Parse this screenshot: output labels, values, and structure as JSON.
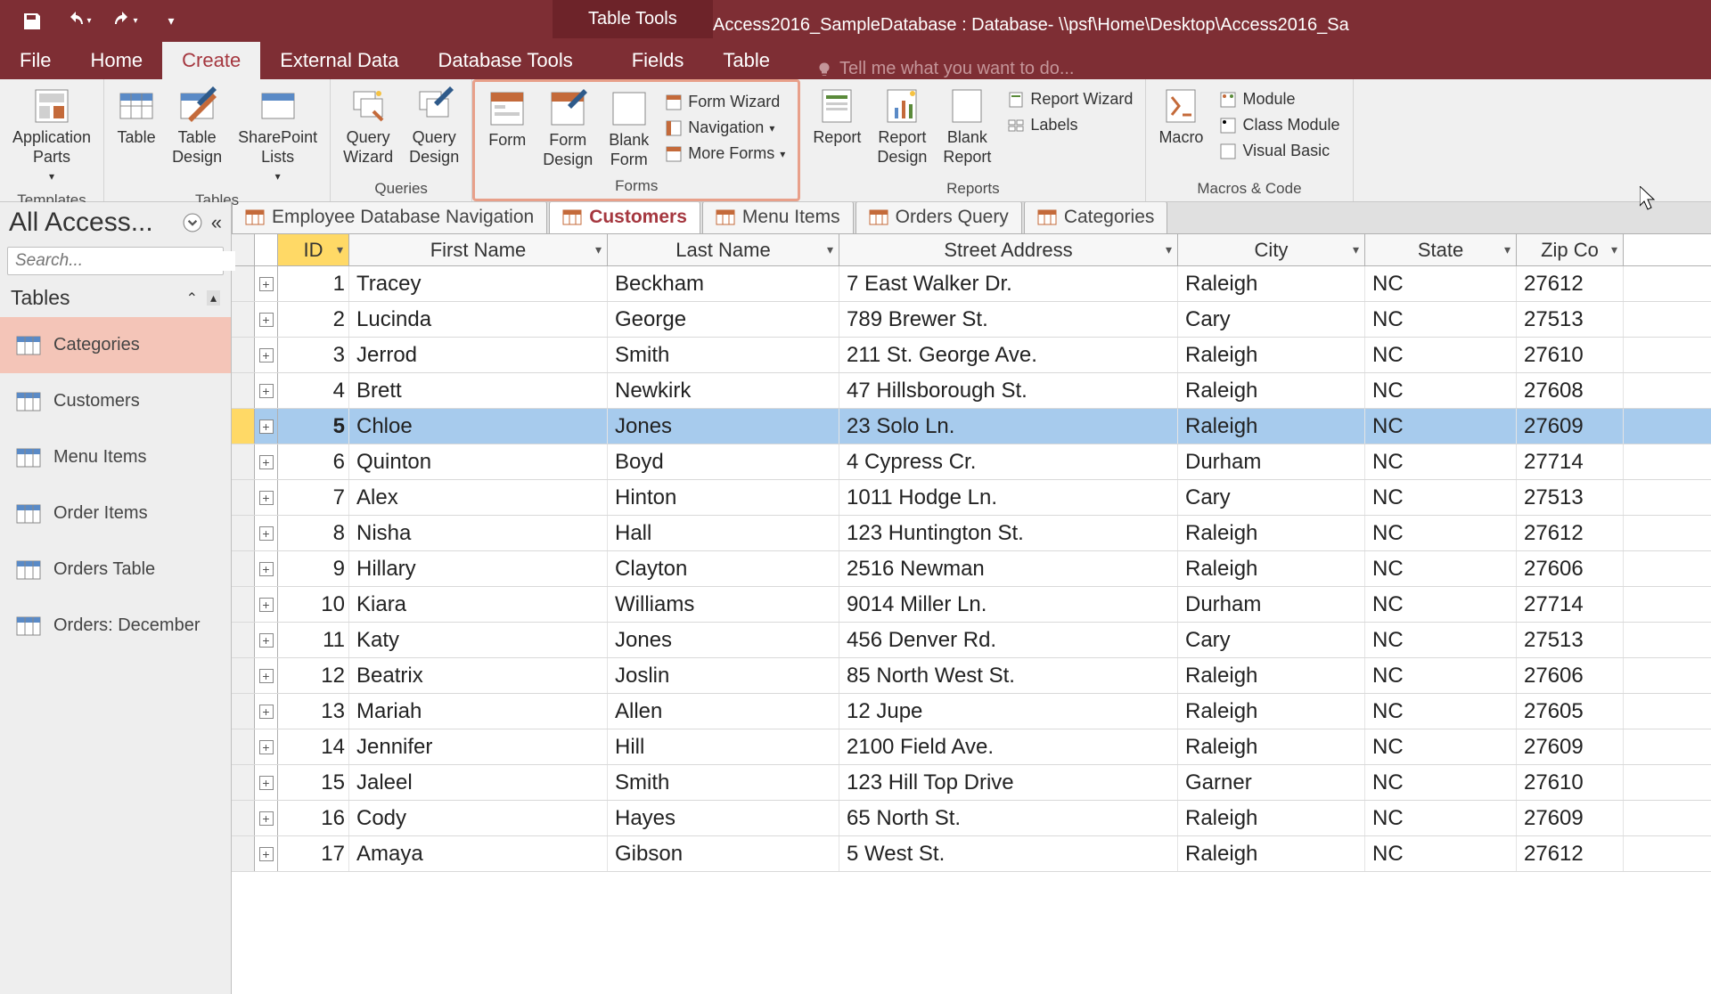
{
  "title": "Access2016_SampleDatabase : Database- \\\\psf\\Home\\Desktop\\Access2016_Sa",
  "tabletools": "Table Tools",
  "tabs": [
    "File",
    "Home",
    "Create",
    "External Data",
    "Database Tools",
    "Fields",
    "Table"
  ],
  "active_tab": "Create",
  "tellme": "Tell me what you want to do...",
  "groups": {
    "templates": {
      "label": "Templates",
      "app_parts": "Application\nParts"
    },
    "tables": {
      "label": "Tables",
      "table": "Table",
      "table_design": "Table\nDesign",
      "sp_lists": "SharePoint\nLists"
    },
    "queries": {
      "label": "Queries",
      "qwizard": "Query\nWizard",
      "qdesign": "Query\nDesign"
    },
    "forms": {
      "label": "Forms",
      "form": "Form",
      "form_design": "Form\nDesign",
      "blank_form": "Blank\nForm",
      "form_wizard": "Form Wizard",
      "navigation": "Navigation",
      "more_forms": "More Forms"
    },
    "reports": {
      "label": "Reports",
      "report": "Report",
      "report_design": "Report\nDesign",
      "blank_report": "Blank\nReport",
      "report_wizard": "Report Wizard",
      "labels": "Labels"
    },
    "macros": {
      "label": "Macros & Code",
      "macro": "Macro",
      "module": "Module",
      "class_module": "Class Module",
      "visual_basic": "Visual Basic"
    }
  },
  "obj_tabs": [
    {
      "label": "Employee Database Navigation",
      "active": false
    },
    {
      "label": "Customers",
      "active": true
    },
    {
      "label": "Menu Items",
      "active": false
    },
    {
      "label": "Orders Query",
      "active": false
    },
    {
      "label": "Categories",
      "active": false
    }
  ],
  "nav": {
    "title": "All Access...",
    "search_placeholder": "Search...",
    "section": "Tables",
    "items": [
      "Categories",
      "Customers",
      "Menu Items",
      "Order Items",
      "Orders Table",
      "Orders: December"
    ],
    "selected": "Categories"
  },
  "columns": [
    "ID",
    "First Name",
    "Last Name",
    "Street Address",
    "City",
    "State",
    "Zip Co"
  ],
  "selected_row_id": 5,
  "rows": [
    {
      "id": 1,
      "fn": "Tracey",
      "ln": "Beckham",
      "sa": "7 East Walker Dr.",
      "ci": "Raleigh",
      "st": "NC",
      "zi": "27612"
    },
    {
      "id": 2,
      "fn": "Lucinda",
      "ln": "George",
      "sa": "789 Brewer St.",
      "ci": "Cary",
      "st": "NC",
      "zi": "27513"
    },
    {
      "id": 3,
      "fn": "Jerrod",
      "ln": "Smith",
      "sa": "211 St. George Ave.",
      "ci": "Raleigh",
      "st": "NC",
      "zi": "27610"
    },
    {
      "id": 4,
      "fn": "Brett",
      "ln": "Newkirk",
      "sa": "47 Hillsborough St.",
      "ci": "Raleigh",
      "st": "NC",
      "zi": "27608"
    },
    {
      "id": 5,
      "fn": "Chloe",
      "ln": "Jones",
      "sa": "23 Solo Ln.",
      "ci": "Raleigh",
      "st": "NC",
      "zi": "27609"
    },
    {
      "id": 6,
      "fn": "Quinton",
      "ln": "Boyd",
      "sa": "4 Cypress Cr.",
      "ci": "Durham",
      "st": "NC",
      "zi": "27714"
    },
    {
      "id": 7,
      "fn": "Alex",
      "ln": "Hinton",
      "sa": "1011 Hodge Ln.",
      "ci": "Cary",
      "st": "NC",
      "zi": "27513"
    },
    {
      "id": 8,
      "fn": "Nisha",
      "ln": "Hall",
      "sa": "123 Huntington St.",
      "ci": "Raleigh",
      "st": "NC",
      "zi": "27612"
    },
    {
      "id": 9,
      "fn": "Hillary",
      "ln": "Clayton",
      "sa": "2516 Newman",
      "ci": "Raleigh",
      "st": "NC",
      "zi": "27606"
    },
    {
      "id": 10,
      "fn": "Kiara",
      "ln": "Williams",
      "sa": "9014 Miller Ln.",
      "ci": "Durham",
      "st": "NC",
      "zi": "27714"
    },
    {
      "id": 11,
      "fn": "Katy",
      "ln": "Jones",
      "sa": "456 Denver Rd.",
      "ci": "Cary",
      "st": "NC",
      "zi": "27513"
    },
    {
      "id": 12,
      "fn": "Beatrix",
      "ln": "Joslin",
      "sa": "85 North West St.",
      "ci": "Raleigh",
      "st": "NC",
      "zi": "27606"
    },
    {
      "id": 13,
      "fn": "Mariah",
      "ln": "Allen",
      "sa": "12 Jupe",
      "ci": "Raleigh",
      "st": "NC",
      "zi": "27605"
    },
    {
      "id": 14,
      "fn": "Jennifer",
      "ln": "Hill",
      "sa": "2100 Field Ave.",
      "ci": "Raleigh",
      "st": "NC",
      "zi": "27609"
    },
    {
      "id": 15,
      "fn": "Jaleel",
      "ln": "Smith",
      "sa": "123 Hill Top Drive",
      "ci": "Garner",
      "st": "NC",
      "zi": "27610"
    },
    {
      "id": 16,
      "fn": "Cody",
      "ln": "Hayes",
      "sa": "65 North St.",
      "ci": "Raleigh",
      "st": "NC",
      "zi": "27609"
    },
    {
      "id": 17,
      "fn": "Amaya",
      "ln": "Gibson",
      "sa": "5 West St.",
      "ci": "Raleigh",
      "st": "NC",
      "zi": "27612"
    }
  ]
}
